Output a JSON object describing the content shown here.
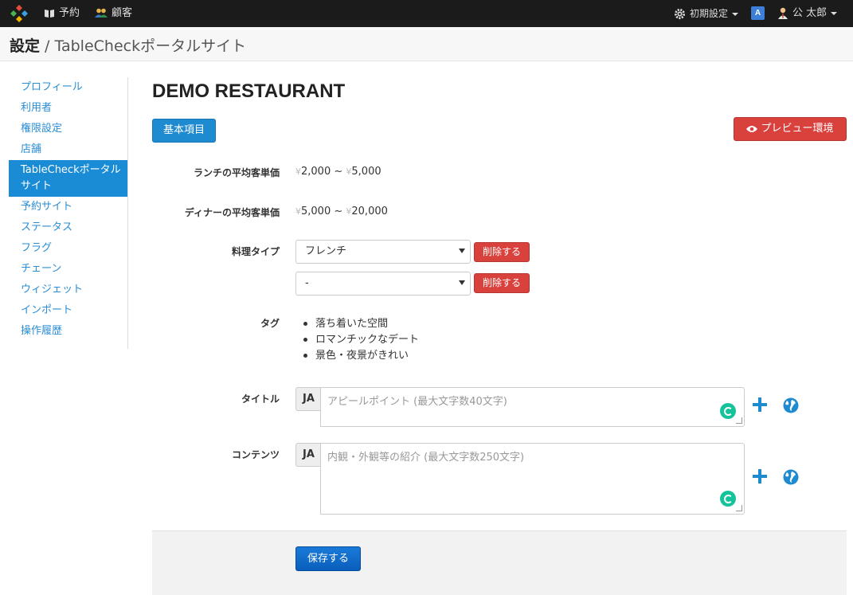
{
  "navbar": {
    "reservations": "予約",
    "customers": "顧客",
    "settings": "初期設定",
    "user": "公 太郎"
  },
  "header": {
    "section": "設定",
    "separator": " / ",
    "page": "TableCheckポータルサイト"
  },
  "sidebar": {
    "items": [
      "プロフィール",
      "利用者",
      "権限設定",
      "店舗",
      "TableCheckポータルサイト",
      "予約サイト",
      "ステータス",
      "フラグ",
      "チェーン",
      "ウィジェット",
      "インポート",
      "操作履歴"
    ],
    "active_index": 4
  },
  "main": {
    "restaurant_name": "DEMO RESTAURANT",
    "tab_basic": "基本項目",
    "preview_button": "プレビュー環境",
    "lunch_label": "ランチの平均客単価",
    "lunch_min": "2,000",
    "lunch_max": "5,000",
    "dinner_label": "ディナーの平均客単価",
    "dinner_min": "5,000",
    "dinner_max": "20,000",
    "yen": "¥",
    "tilde": " ~ ",
    "cuisine_label": "料理タイプ",
    "cuisine_values": [
      "フレンチ",
      "-"
    ],
    "delete_label": "削除する",
    "tag_label": "タグ",
    "tags": [
      "落ち着いた空間",
      "ロマンチックなデート",
      "景色・夜景がきれい"
    ],
    "title_label": "タイトル",
    "title_lang": "JA",
    "title_placeholder": "アピールポイント (最大文字数40文字)",
    "content_label": "コンテンツ",
    "content_lang": "JA",
    "content_placeholder": "内観・外観等の紹介 (最大文字数250文字)",
    "save_button": "保存する"
  },
  "colors": {
    "primary": "#1e8ad0",
    "danger": "#d9413d",
    "navbar": "#1b1b1b",
    "sidebar_active": "#1a8bd5",
    "link": "#2a8dd4"
  }
}
